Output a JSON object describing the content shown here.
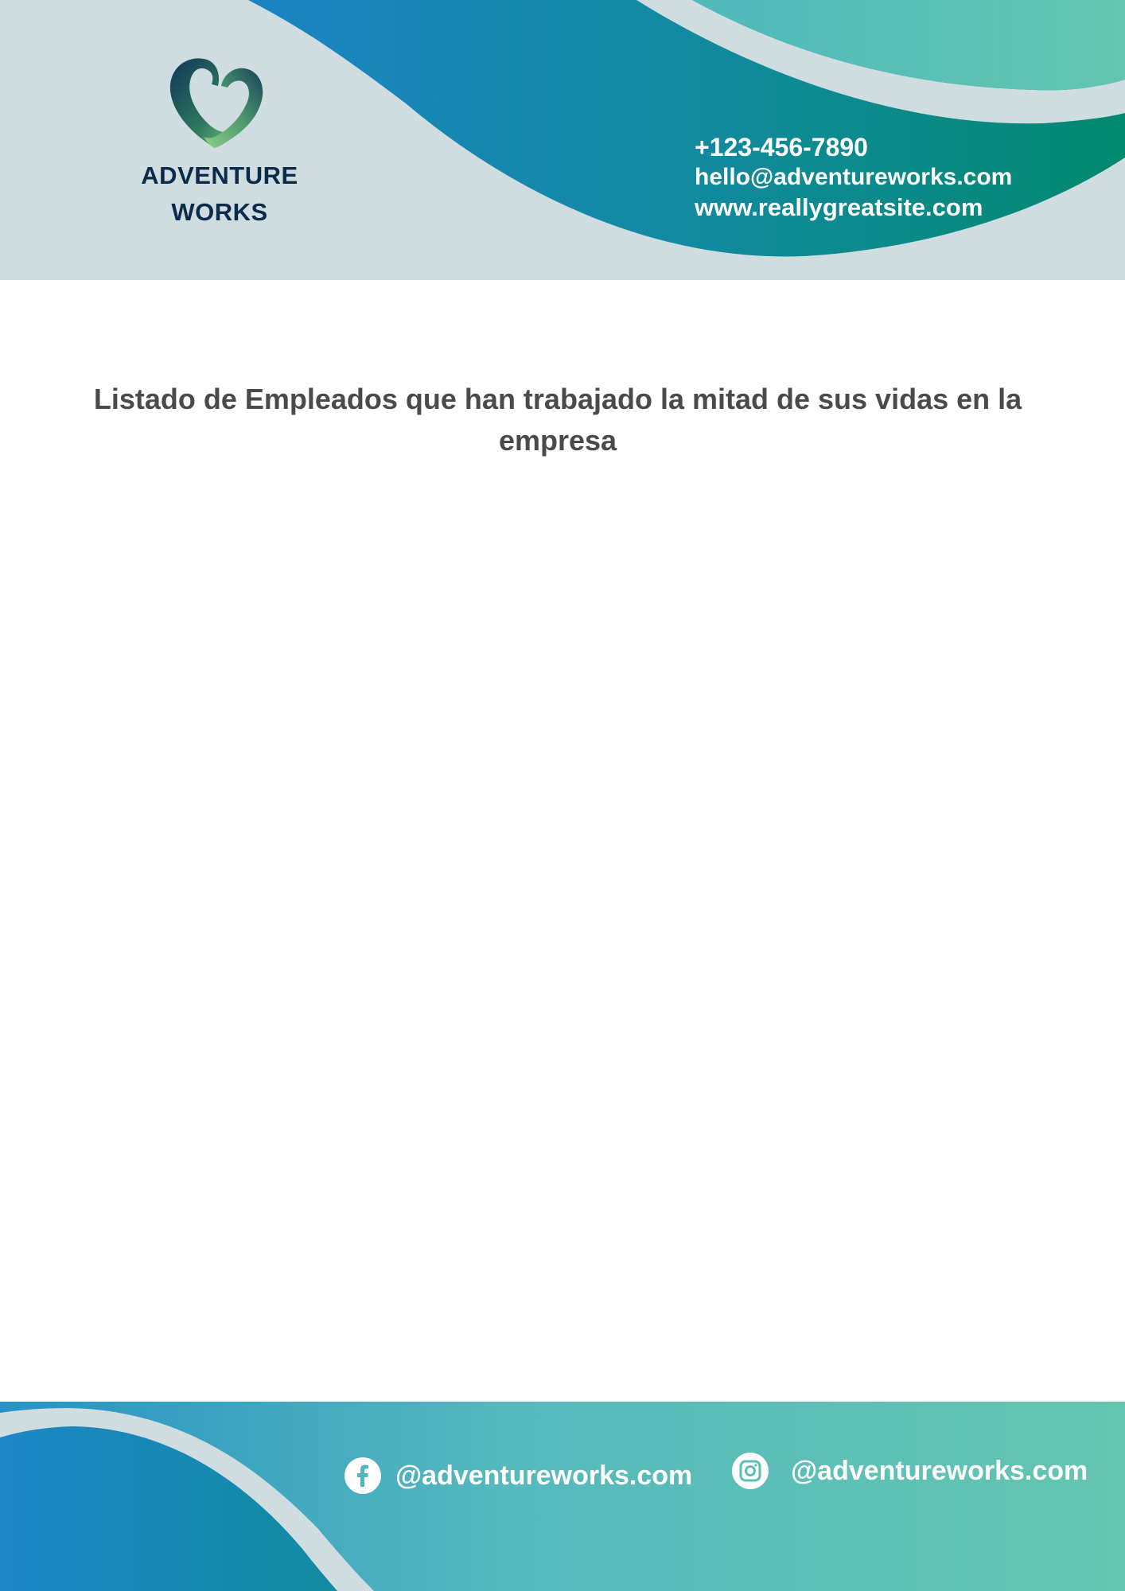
{
  "brand": {
    "line1": "ADVENTURE",
    "line2": "WORKS",
    "icon": "heart-logo-icon"
  },
  "contact": {
    "phone": "+123-456-7890",
    "email": "hello@adventureworks.com",
    "website": "www.reallygreatsite.com"
  },
  "document": {
    "title": "Listado de Empleados que han trabajado la mitad de sus vidas en la empresa"
  },
  "footer": {
    "facebook": {
      "icon": "facebook-icon",
      "handle": "@adventureworks.com"
    },
    "instagram": {
      "icon": "instagram-icon",
      "handle": "@adventureworks.com"
    }
  },
  "colors": {
    "header_bg": "#cfdde1",
    "wave_blue": "#1486b5",
    "wave_teal": "#02896f",
    "light_teal": "#62c4b0",
    "brand_text": "#0c2b4b",
    "title_text": "#4a4a4a"
  }
}
